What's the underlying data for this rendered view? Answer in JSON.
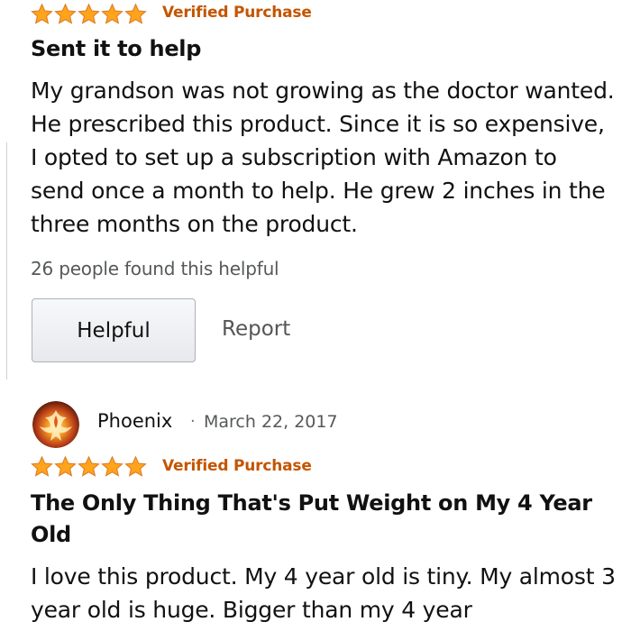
{
  "colors": {
    "star": "#ffa41c",
    "star_edge": "#de7921",
    "verified": "#c45500",
    "text": "#111111",
    "muted": "#565959"
  },
  "review1": {
    "rating": 5,
    "verified_label": "Verified Purchase",
    "title": "Sent it to help",
    "body": "My grandson was not growing as the doctor wanted. He prescribed this product. Since it is so expensive, I opted to set up a subscription with Amazon to send once a month to help. He grew 2 inches in the three months on the product.",
    "helpful_count": "26 people found this helpful",
    "helpful_button": "Helpful",
    "report_link": "Report"
  },
  "review2": {
    "reviewer": "Phoenix",
    "separator": "·",
    "date": "March 22, 2017",
    "avatar_icon": "phoenix-avatar-icon",
    "rating": 5,
    "verified_label": "Verified Purchase",
    "title": "The Only Thing That's Put Weight on My 4 Year Old",
    "body": "I love this product. My 4 year old is tiny. My almost 3 year old is huge. Bigger than my 4 year"
  }
}
